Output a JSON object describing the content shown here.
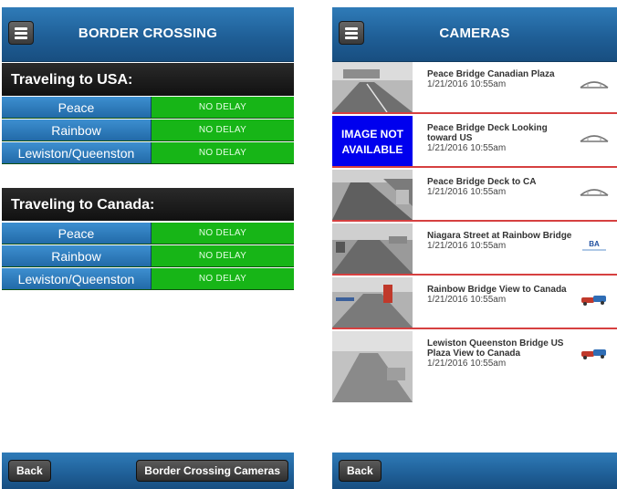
{
  "left": {
    "title": "BORDER CROSSING",
    "sections": [
      {
        "heading": "Traveling to USA:",
        "rows": [
          {
            "name": "Peace",
            "status": "NO DELAY"
          },
          {
            "name": "Rainbow",
            "status": "NO DELAY"
          },
          {
            "name": "Lewiston/Queenston",
            "status": "NO DELAY"
          }
        ]
      },
      {
        "heading": "Traveling to Canada:",
        "rows": [
          {
            "name": "Peace",
            "status": "NO DELAY"
          },
          {
            "name": "Rainbow",
            "status": "NO DELAY"
          },
          {
            "name": "Lewiston/Queenston",
            "status": "NO DELAY"
          }
        ]
      }
    ],
    "footer": {
      "back": "Back",
      "cameras": "Border Crossing Cameras"
    }
  },
  "right": {
    "title": "CAMERAS",
    "cameras": [
      {
        "title": "Peace Bridge Canadian Plaza",
        "time": "1/21/2016 10:55am",
        "thumb": "road",
        "logo": "bridge-logo"
      },
      {
        "title": "Peace Bridge Deck Looking toward US",
        "time": "1/21/2016 10:55am",
        "thumb": "na",
        "thumb_text": "IMAGE NOT AVAILABLE",
        "logo": "bridge-logo"
      },
      {
        "title": "Peace Bridge Deck to CA",
        "time": "1/21/2016 10:55am",
        "thumb": "road",
        "logo": "bridge-logo"
      },
      {
        "title": "Niagara Street at Rainbow Bridge",
        "time": "1/21/2016 10:55am",
        "thumb": "road",
        "logo": "authority-logo"
      },
      {
        "title": "Rainbow Bridge View to Canada",
        "time": "1/21/2016 10:55am",
        "thumb": "road",
        "logo": "car-logo"
      },
      {
        "title": "Lewiston Queenston Bridge US Plaza View to Canada",
        "time": "1/21/2016 10:55am",
        "thumb": "road",
        "logo": "car-logo"
      }
    ],
    "footer": {
      "back": "Back"
    }
  },
  "colors": {
    "header_blue": "#1f5f97",
    "status_green": "#17b517",
    "unavailable_blue": "#0000ee",
    "divider_red": "#d64040"
  }
}
